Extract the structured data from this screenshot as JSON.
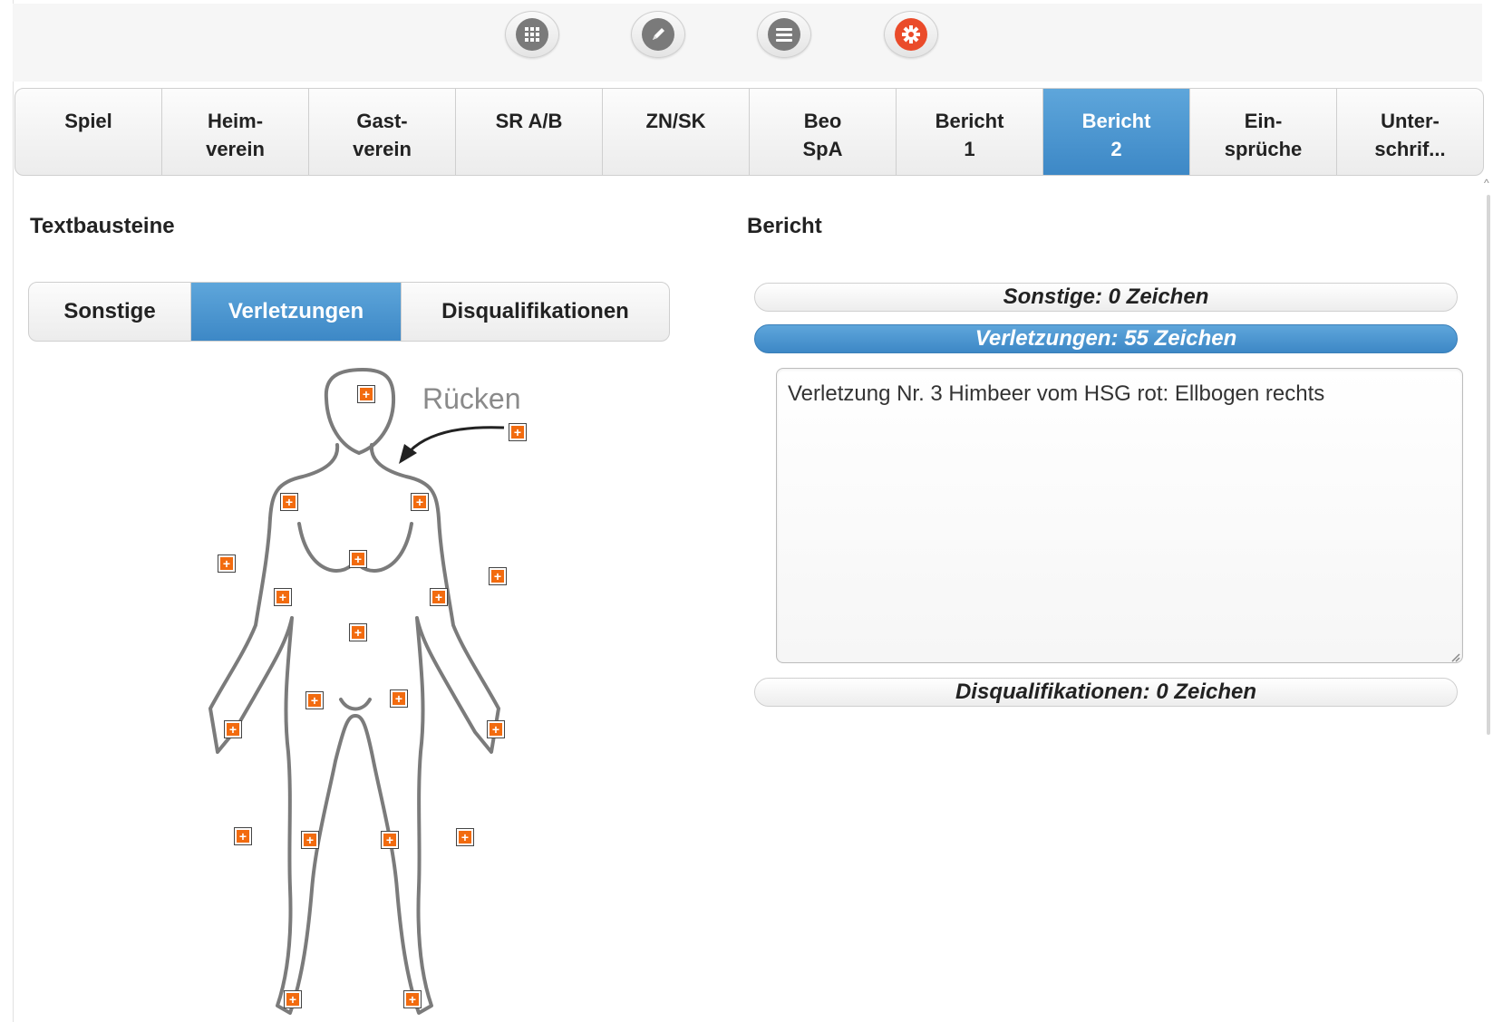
{
  "toolbar": {
    "icons": [
      "grid-icon",
      "pencil-icon",
      "list-icon",
      "settings-icon"
    ],
    "accent_color": "#ea4b2a"
  },
  "tabs": [
    {
      "label": "Spiel",
      "active": false
    },
    {
      "label": "Heim-\nverein",
      "active": false
    },
    {
      "label": "Gast-\nverein",
      "active": false
    },
    {
      "label": "SR A/B",
      "active": false
    },
    {
      "label": "ZN/SK",
      "active": false
    },
    {
      "label": "Beo\nSpA",
      "active": false
    },
    {
      "label": "Bericht\n1",
      "active": false
    },
    {
      "label": "Bericht\n2",
      "active": true
    },
    {
      "label": "Ein-\nsprüche",
      "active": false
    },
    {
      "label": "Unter-\nschrif..."
    }
  ],
  "left_panel": {
    "title": "Textbausteine",
    "subtabs": [
      {
        "label": "Sonstige",
        "active": false
      },
      {
        "label": "Verletzungen",
        "active": true
      },
      {
        "label": "Disqualifikationen",
        "active": false
      }
    ],
    "body_label": "Rücken",
    "marker_color": "#f26b0f"
  },
  "right_panel": {
    "title": "Bericht",
    "sections": [
      {
        "label": "Sonstige: 0 Zeichen",
        "active": false
      },
      {
        "label": "Verletzungen: 55 Zeichen",
        "active": true
      },
      {
        "label": "Disqualifikationen: 0 Zeichen",
        "active": false
      }
    ],
    "report_text": "Verletzung Nr. 3 Himbeer vom HSG rot: Ellbogen rechts"
  },
  "active_color": "#4a92cf"
}
